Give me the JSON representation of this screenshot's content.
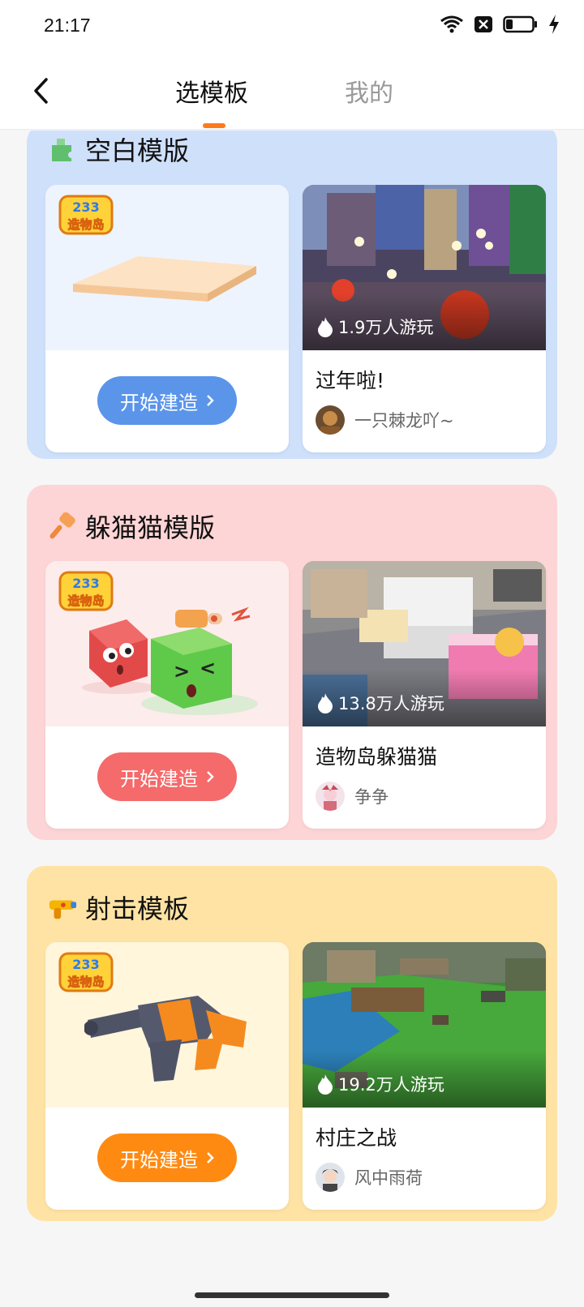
{
  "status": {
    "time": "21:17"
  },
  "header": {
    "tabs": [
      {
        "label": "选模板",
        "active": true
      },
      {
        "label": "我的",
        "active": false
      }
    ]
  },
  "sections": [
    {
      "title": "空白模版",
      "icon": "puzzle-icon",
      "bg_color": "#cfe0fb",
      "button_color": "#5b95ea",
      "template": {
        "logo": "233造物岛",
        "button_label": "开始建造"
      },
      "game": {
        "plays": "1.9万人游玩",
        "title": "过年啦!",
        "author": "一只棘龙吖~"
      }
    },
    {
      "title": "躲猫猫模版",
      "icon": "hammer-icon",
      "bg_color": "#fdd5d6",
      "button_color": "#f56a6a",
      "template": {
        "logo": "233造物岛",
        "button_label": "开始建造"
      },
      "game": {
        "plays": "13.8万人游玩",
        "title": "造物岛躲猫猫",
        "author": "争争"
      }
    },
    {
      "title": "射击模板",
      "icon": "gun-icon",
      "bg_color": "#fee3a4",
      "button_color": "#ff8a12",
      "template": {
        "logo": "233造物岛",
        "button_label": "开始建造"
      },
      "game": {
        "plays": "19.2万人游玩",
        "title": "村庄之战",
        "author": "风中雨荷"
      }
    }
  ]
}
